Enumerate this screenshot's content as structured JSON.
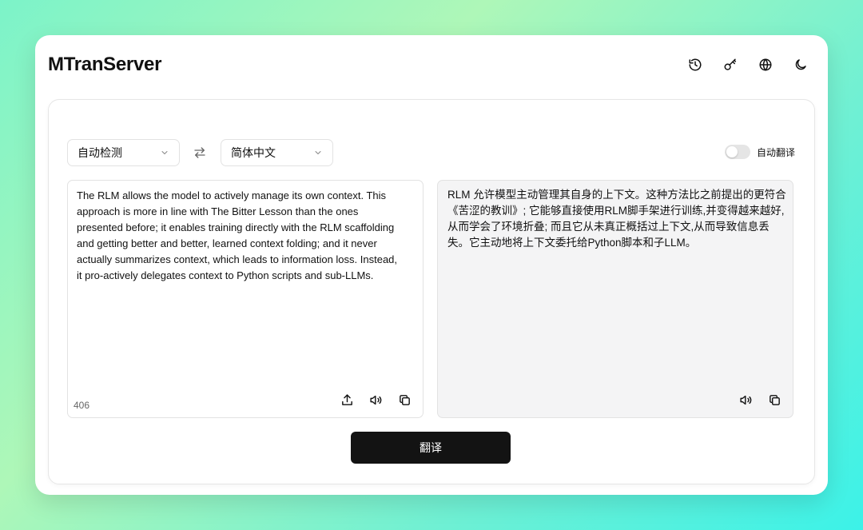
{
  "app": {
    "title": "MTranServer"
  },
  "header": {
    "icons": [
      "history-icon",
      "key-icon",
      "globe-icon",
      "moon-icon"
    ]
  },
  "languages": {
    "source": "自动检测",
    "target": "简体中文"
  },
  "auto_translate": {
    "label": "自动翻译",
    "enabled": false
  },
  "source_panel": {
    "text": "The RLM allows the model to actively manage its own context. This approach is more in line with The Bitter Lesson than the ones presented before; it enables training directly with the RLM scaffolding and getting better and better, learned context folding; and it never actually summarizes context, which leads to information loss. Instead, it pro-actively delegates context to Python scripts and sub-LLMs.",
    "char_count": "406"
  },
  "target_panel": {
    "text": "RLM 允许模型主动管理其自身的上下文。这种方法比之前提出的更符合《苦涩的教训》; 它能够直接使用RLM脚手架进行训练,并变得越来越好,从而学会了环境折叠; 而且它从未真正概括过上下文,从而导致信息丢失。它主动地将上下文委托给Python脚本和子LLM。"
  },
  "actions": {
    "translate_label": "翻译"
  },
  "colors": {
    "accent": "#131313",
    "panel_bg": "#f4f4f5"
  }
}
